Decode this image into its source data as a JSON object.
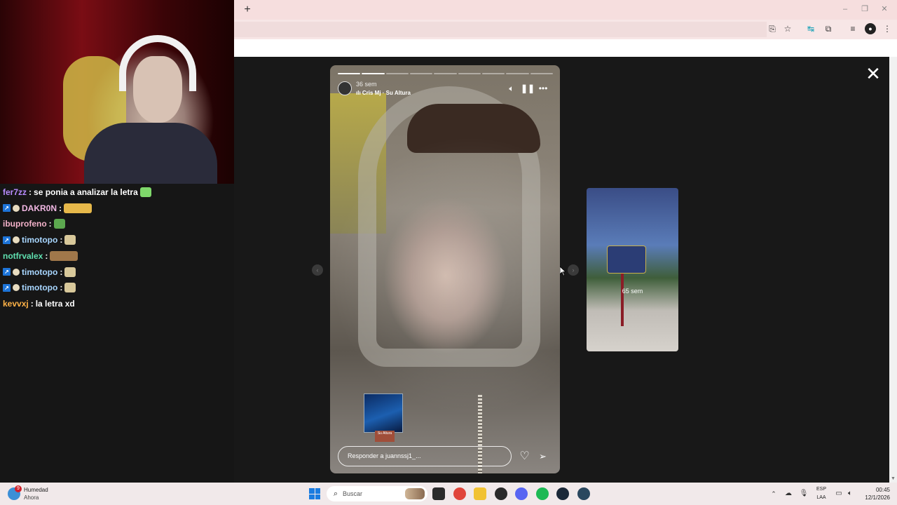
{
  "browser": {
    "new_tab_glyph": "+",
    "window_controls": [
      "–",
      "❐",
      "✕"
    ],
    "toolbar_icons": [
      "install-icon",
      "star-icon",
      "extension-translate-icon",
      "puzzle-icon",
      "media-icon",
      "profile-icon",
      "more-icon"
    ]
  },
  "chat": {
    "messages": [
      {
        "user": "fer7zz",
        "user_color": "#b98cff",
        "sep": ":",
        "text": "se ponia a analizar la letra",
        "emote": true,
        "badges": false
      },
      {
        "user": "DAKR0N",
        "user_color": "#f2b8e4",
        "sep": ":",
        "text": "",
        "emote": true,
        "badges": true
      },
      {
        "user": "ibuprofeno",
        "user_color": "#f3b1c9",
        "sep": ":",
        "text": "",
        "emote": true,
        "badges": false
      },
      {
        "user": "timotopo",
        "user_color": "#a8d6ff",
        "sep": ":",
        "text": "",
        "emote": true,
        "badges": true
      },
      {
        "user": "notfrvalex",
        "user_color": "#5fe0b0",
        "sep": ":",
        "text": "",
        "emote": true,
        "badges": false
      },
      {
        "user": "timotopo",
        "user_color": "#a8d6ff",
        "sep": ":",
        "text": "",
        "emote": true,
        "badges": true
      },
      {
        "user": "timotopo",
        "user_color": "#a8d6ff",
        "sep": ":",
        "text": "",
        "emote": true,
        "badges": true
      },
      {
        "user": "kevvxj",
        "user_color": "#ffb347",
        "sep": ":",
        "text": "la letra xd",
        "emote": false,
        "badges": false
      }
    ]
  },
  "story": {
    "time_ago": "36 sem",
    "music": "Cris Mj · Su Altura",
    "segments_total": 9,
    "segments_done": 2,
    "reply_placeholder": "Responder a juannssj1_...",
    "controls": [
      "volume-icon",
      "pause-icon",
      "more-options-icon"
    ],
    "album_label": "Su Altura"
  },
  "next_story": {
    "time_ago": "65 sem"
  },
  "viewer": {
    "close_glyph": "✕",
    "prev_glyph": "‹",
    "next_glyph": "›"
  },
  "taskbar": {
    "weather_title": "Humedad",
    "weather_sub": "Ahora",
    "weather_badge": "9",
    "search_placeholder": "Buscar",
    "apps": [
      {
        "name": "task-view-icon",
        "color": "#2b2b2b"
      },
      {
        "name": "chrome-icon",
        "color": "#e0453a"
      },
      {
        "name": "file-explorer-icon",
        "color": "#f1c232"
      },
      {
        "name": "obs-icon",
        "color": "#2a2a2a"
      },
      {
        "name": "discord-icon",
        "color": "#5865f2"
      },
      {
        "name": "spotify-icon",
        "color": "#1db954"
      },
      {
        "name": "steam-icon",
        "color": "#1b2838"
      },
      {
        "name": "steam-alt-icon",
        "color": "#2a475e"
      }
    ],
    "lang": "ESP",
    "lang_sub": "LAA",
    "time": "00:45",
    "date": "12/1/2026"
  }
}
